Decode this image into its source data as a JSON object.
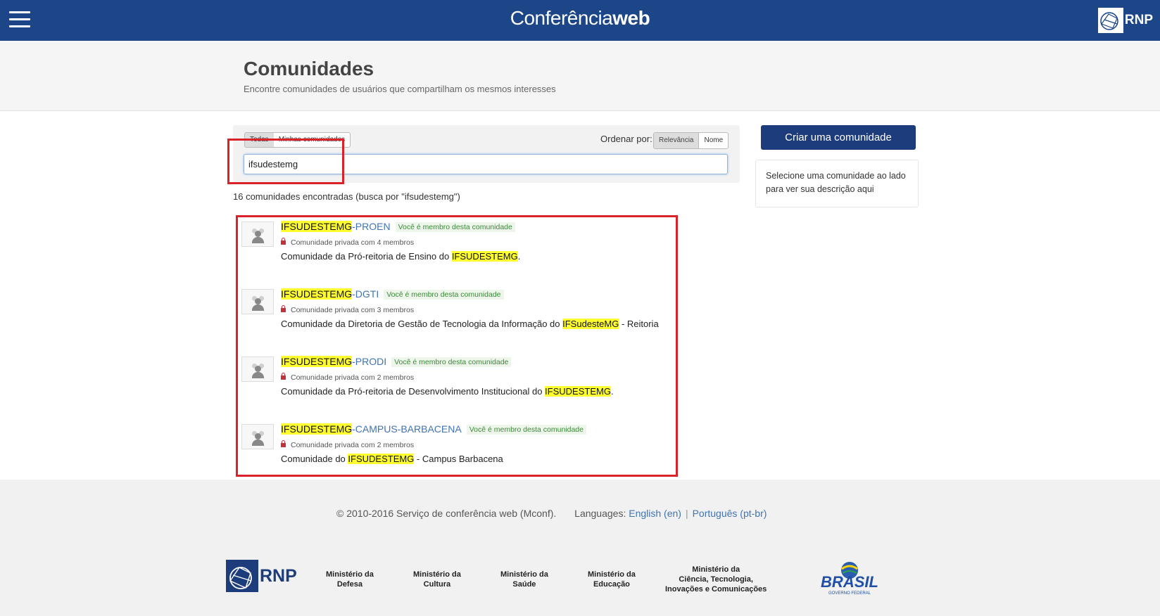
{
  "topbar": {
    "brand_light": "Conferência",
    "brand_bold": "web",
    "partner_logo_text": "RNP"
  },
  "header": {
    "title": "Comunidades",
    "subtitle": "Encontre comunidades de usuários que compartilham os mesmos interesses"
  },
  "filters": {
    "scope_tabs": [
      "Todas",
      "Minhas comunidades"
    ],
    "active_scope": "Todas",
    "order_label": "Ordenar por:",
    "order_options": [
      "Relevância",
      "Nome"
    ],
    "active_order": "Relevância",
    "search_value": "ifsudestemg"
  },
  "results": {
    "count_text": "16 comunidades encontradas (busca por \"ifsudestemg\")",
    "items": [
      {
        "name_highlight": "IFSUDESTEMG",
        "name_suffix": "-PROEN",
        "badge": "Você é membro desta comunidade",
        "meta": "Comunidade privada com 4 membros",
        "desc_before": "Comunidade da Pró-reitoria de Ensino do ",
        "desc_highlight": "IFSUDESTEMG",
        "desc_after": "."
      },
      {
        "name_highlight": "IFSUDESTEMG",
        "name_suffix": "-DGTI",
        "badge": "Você é membro desta comunidade",
        "meta": "Comunidade privada com 3 membros",
        "desc_before": "Comunidade da Diretoria de Gestão de Tecnologia da Informação do ",
        "desc_highlight": "IFSudesteMG",
        "desc_after": " - Reitoria"
      },
      {
        "name_highlight": "IFSUDESTEMG",
        "name_suffix": "-PRODI",
        "badge": "Você é membro desta comunidade",
        "meta": "Comunidade privada com 2 membros",
        "desc_before": "Comunidade da Pró-reitoria de Desenvolvimento Institucional do ",
        "desc_highlight": "IFSUDESTEMG",
        "desc_after": "."
      },
      {
        "name_highlight": "IFSUDESTEMG",
        "name_suffix": "-CAMPUS-BARBACENA",
        "badge": "Você é membro desta comunidade",
        "meta": "Comunidade privada com 2 membros",
        "desc_before": "Comunidade do ",
        "desc_highlight": "IFSUDESTEMG",
        "desc_after": " - Campus Barbacena"
      }
    ]
  },
  "sidebar": {
    "create_button": "Criar uma comunidade",
    "info_text": "Selecione uma comunidade ao lado para ver sua descrição aqui"
  },
  "footer": {
    "copyright": "© 2010-2016 Serviço de conferência web (Mconf).",
    "languages_label": "Languages:",
    "lang_en": "English (en)",
    "lang_pt": "Português (pt-br)",
    "rnp_text": "RNP",
    "ministries": [
      {
        "line1": "Ministério da",
        "line2": "Defesa"
      },
      {
        "line1": "Ministério da",
        "line2": "Cultura"
      },
      {
        "line1": "Ministério da",
        "line2": "Saúde"
      },
      {
        "line1": "Ministério da",
        "line2": "Educação"
      },
      {
        "line1": "Ministério da",
        "line2": "Ciência, Tecnologia,",
        "line3": "Inovações e Comunicações"
      }
    ],
    "brasil_logo_text": "BRASIL",
    "brasil_logo_sub": "GOVERNO FEDERAL"
  },
  "icons": {
    "menu": "hamburger-icon",
    "lock": "lock-icon",
    "avatar": "group-avatar-icon"
  },
  "colors": {
    "topbar": "#1c4688",
    "highlight": "#ffff30",
    "link": "#3f74b5",
    "primary_button": "#1c3c7c",
    "annotation_red": "#d9222a"
  }
}
